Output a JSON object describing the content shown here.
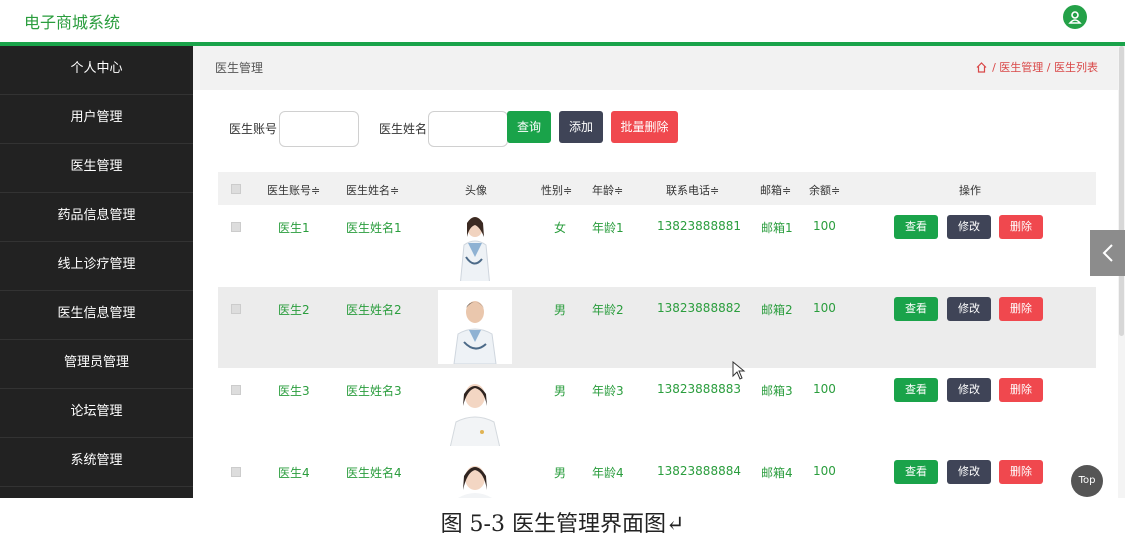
{
  "app": {
    "title": "电子商城系统"
  },
  "sidebar": {
    "items": [
      {
        "label": "个人中心"
      },
      {
        "label": "用户管理"
      },
      {
        "label": "医生管理"
      },
      {
        "label": "药品信息管理"
      },
      {
        "label": "线上诊疗管理"
      },
      {
        "label": "医生信息管理"
      },
      {
        "label": "管理员管理"
      },
      {
        "label": "论坛管理"
      },
      {
        "label": "系统管理"
      }
    ]
  },
  "page": {
    "title": "医生管理",
    "breadcrumb": {
      "section": "医生管理",
      "sep": "/",
      "current": "医生列表"
    }
  },
  "search": {
    "account_label": "医生账号",
    "account_value": "",
    "name_label": "医生姓名",
    "name_value": "",
    "query_label": "查询",
    "add_label": "添加",
    "batch_delete_label": "批量删除"
  },
  "table": {
    "columns": {
      "account": "医生账号≑",
      "name": "医生姓名≑",
      "avatar": "头像",
      "gender": "性别≑",
      "age": "年龄≑",
      "phone": "联系电话≑",
      "email": "邮箱≑",
      "balance": "余额≑",
      "actions": "操作"
    },
    "rows": [
      {
        "account": "医生1",
        "name": "医生姓名1",
        "gender": "女",
        "age": "年龄1",
        "phone": "13823888881",
        "email": "邮箱1",
        "balance": "100"
      },
      {
        "account": "医生2",
        "name": "医生姓名2",
        "gender": "男",
        "age": "年龄2",
        "phone": "13823888882",
        "email": "邮箱2",
        "balance": "100"
      },
      {
        "account": "医生3",
        "name": "医生姓名3",
        "gender": "男",
        "age": "年龄3",
        "phone": "13823888883",
        "email": "邮箱3",
        "balance": "100"
      },
      {
        "account": "医生4",
        "name": "医生姓名4",
        "gender": "男",
        "age": "年龄4",
        "phone": "13823888884",
        "email": "邮箱4",
        "balance": "100"
      }
    ],
    "view_label": "查看",
    "edit_label": "修改",
    "delete_label": "删除"
  },
  "floating": {
    "top_label": "Top"
  },
  "caption": "图 5-3 医生管理界面图↵",
  "colors": {
    "accent": "#1aa34a",
    "danger": "#f0484e",
    "dark_button": "#3f4457",
    "sidebar": "#222222"
  }
}
